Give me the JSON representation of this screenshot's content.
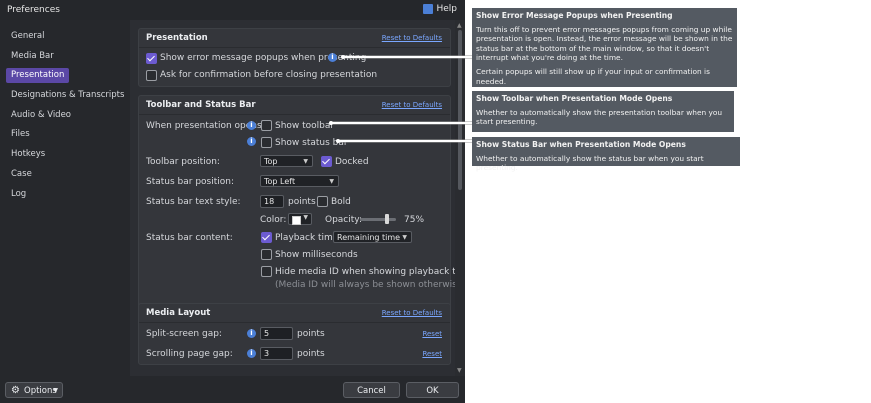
{
  "window": {
    "title": "Preferences",
    "help_label": "Help"
  },
  "sidebar": {
    "items": [
      {
        "label": "General"
      },
      {
        "label": "Media Bar"
      },
      {
        "label": "Presentation"
      },
      {
        "label": "Designations & Transcripts"
      },
      {
        "label": "Audio & Video"
      },
      {
        "label": "Files"
      },
      {
        "label": "Hotkeys"
      },
      {
        "label": "Case"
      },
      {
        "label": "Log"
      }
    ],
    "active": "Presentation"
  },
  "presentation": {
    "title": "Presentation",
    "reset": "Reset to Defaults",
    "show_error_popups": {
      "label": "Show error message popups when presenting",
      "checked": true
    },
    "ask_confirm_close": {
      "label": "Ask for confirmation before closing presentation",
      "checked": false
    }
  },
  "toolbar_status": {
    "title": "Toolbar and Status Bar",
    "reset": "Reset to Defaults",
    "when_opens_label": "When presentation opens:",
    "show_toolbar": {
      "label": "Show toolbar",
      "checked": false
    },
    "show_status_bar": {
      "label": "Show status bar",
      "checked": false
    },
    "toolbar_position_label": "Toolbar position:",
    "toolbar_position_value": "Top",
    "docked": {
      "label": "Docked",
      "checked": true
    },
    "status_bar_position_label": "Status bar position:",
    "status_bar_position_value": "Top Left",
    "text_style_label": "Status bar text style:",
    "text_size_value": "18",
    "points_label": "points",
    "bold": {
      "label": "Bold",
      "checked": false
    },
    "color_label": "Color:",
    "color_value": "#ffffff",
    "opacity_label": "Opacity:",
    "opacity_value": "75%",
    "opacity_fraction": 0.75,
    "content_label": "Status bar content:",
    "playback_time": {
      "label": "Playback time:",
      "checked": true
    },
    "playback_time_value": "Remaining time",
    "show_ms": {
      "label": "Show milliseconds",
      "checked": false
    },
    "hide_media_id": {
      "label": "Hide media ID when showing playback time",
      "checked": false
    },
    "media_id_note": "(Media ID will always be shown otherwise)"
  },
  "media_layout": {
    "title": "Media Layout",
    "reset": "Reset to Defaults",
    "split_gap_label": "Split-screen gap:",
    "split_gap_value": "5",
    "scroll_gap_label": "Scrolling page gap:",
    "scroll_gap_value": "3",
    "points_label": "points",
    "reset_small": "Reset"
  },
  "footer": {
    "options_label": "Options",
    "cancel_label": "Cancel",
    "ok_label": "OK"
  },
  "tooltips": [
    {
      "title": "Show Error Message Popups when Presenting",
      "body": [
        "Turn this off to prevent error messages popups from coming up while presentation is open. Instead, the error message will be shown in the status bar at the bottom of the main window, so that it doesn't interrupt what you're doing at the time.",
        "Certain popups will still show up if your input or confirmation is needed."
      ]
    },
    {
      "title": "Show Toolbar when Presentation Mode Opens",
      "body": [
        "Whether to automatically show the presentation toolbar when you start presenting."
      ]
    },
    {
      "title": "Show Status Bar when Presentation Mode Opens",
      "body": [
        "Whether to automatically show the status bar when you start presenting."
      ]
    }
  ],
  "colors": {
    "accent": "#6c5bd1",
    "active_nav": "#5b48a6",
    "info": "#4b7fd6",
    "link": "#7aa7ff"
  }
}
